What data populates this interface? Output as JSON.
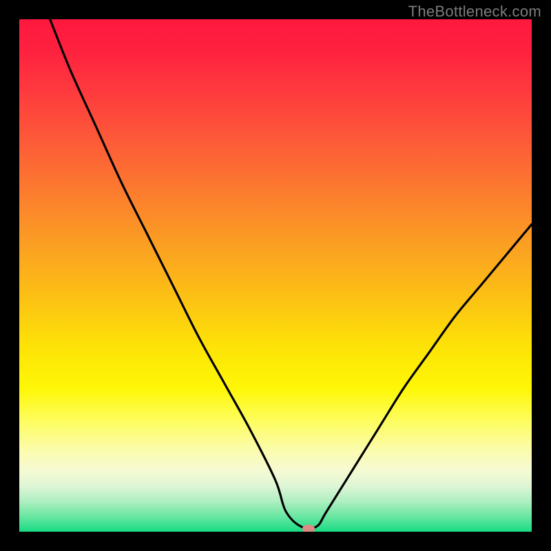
{
  "watermark": "TheBottleneck.com",
  "chart_data": {
    "type": "line",
    "title": "",
    "xlabel": "",
    "ylabel": "",
    "xlim": [
      0,
      100
    ],
    "ylim": [
      0,
      100
    ],
    "grid": false,
    "legend": false,
    "background_gradient": {
      "direction": "vertical",
      "stops": [
        {
          "pos": 0.0,
          "color": "#fe183f"
        },
        {
          "pos": 0.34,
          "color": "#fc7d2e"
        },
        {
          "pos": 0.64,
          "color": "#fde307"
        },
        {
          "pos": 0.88,
          "color": "#f6fad2"
        },
        {
          "pos": 1.0,
          "color": "#17db83"
        }
      ]
    },
    "series": [
      {
        "name": "bottleneck-curve",
        "x": [
          6,
          10,
          15,
          20,
          25,
          30,
          35,
          40,
          45,
          50,
          52,
          55,
          58,
          60,
          65,
          70,
          75,
          80,
          85,
          90,
          95,
          100
        ],
        "y": [
          100,
          90,
          79,
          68,
          58,
          48,
          38,
          29,
          20,
          10,
          4,
          1,
          1,
          4,
          12,
          20,
          28,
          35,
          42,
          48,
          54,
          60
        ]
      }
    ],
    "marker": {
      "x": 56.5,
      "y": 0.5,
      "color": "#db8c86"
    }
  }
}
